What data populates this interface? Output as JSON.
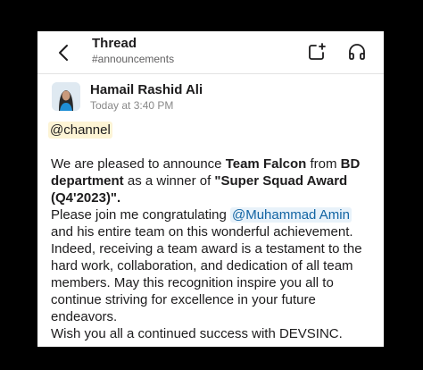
{
  "header": {
    "title": "Thread",
    "channel": "#announcements"
  },
  "message": {
    "author": "Hamail Rashid Ali",
    "timestamp": "Today at 3:40 PM",
    "channel_mention": "@channel",
    "p1_intro": "We are pleased to announce ",
    "p1_team": "Team Falcon",
    "p1_from": " from ",
    "p1_dept": "BD department",
    "p1_as": " as a winner of ",
    "p1_award": "\"Super Squad Award (Q4'2023)\".",
    "p2_start": "Please join me congratulating ",
    "p2_mention": "@Muhammad Amin",
    "p2_rest": " and his entire team on this wonderful achievement. Indeed, receiving a team award is a testament to the hard work, collaboration, and dedication of all team members. May this recognition inspire you all to continue striving for excellence in your future endeavors.",
    "p3": "Wish you all a continued success with DEVSINC."
  }
}
